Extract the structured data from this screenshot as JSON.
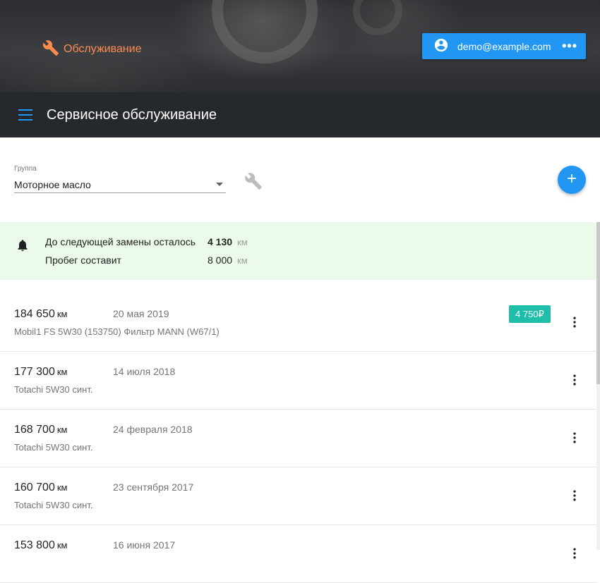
{
  "header": {
    "brand": "Обслуживание",
    "user_email": "demo@example.com",
    "more_label": "•••",
    "brand_color": "#ff8a50",
    "accent_color": "#2196f3"
  },
  "toolbar": {
    "title": "Сервисное обслуживание"
  },
  "filter": {
    "label": "Группа",
    "value": "Моторное масло"
  },
  "notice": {
    "row1_label": "До следующей замены осталось",
    "row1_value": "4 130",
    "row1_unit": "км",
    "row2_label": "Пробег составит",
    "row2_value": "8 000",
    "row2_unit": "км"
  },
  "records": [
    {
      "km": "184 650",
      "unit": "км",
      "date": "20 мая 2019",
      "desc": "Mobil1 FS 5W30 (153750) Фильтр MANN (W67/1)",
      "price": "4 750₽"
    },
    {
      "km": "177 300",
      "unit": "км",
      "date": "14 июля 2018",
      "desc": "Totachi 5W30 синт.",
      "price": ""
    },
    {
      "km": "168 700",
      "unit": "км",
      "date": "24 февраля 2018",
      "desc": "Totachi 5W30 синт.",
      "price": ""
    },
    {
      "km": "160 700",
      "unit": "км",
      "date": "23 сентября 2017",
      "desc": "Totachi 5W30 синт.",
      "price": ""
    },
    {
      "km": "153 800",
      "unit": "км",
      "date": "16 июня 2017",
      "desc": "",
      "price": ""
    }
  ]
}
